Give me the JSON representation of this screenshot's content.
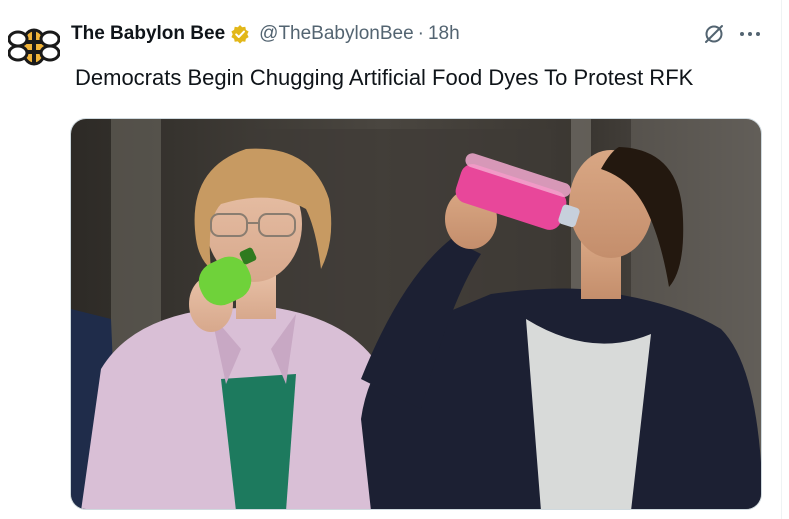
{
  "tweet": {
    "display_name": "The Babylon Bee",
    "handle": "@TheBabylonBee",
    "separator": "·",
    "time": "18h",
    "text": "Democrats Begin Chugging Artificial Food Dyes To Protest RFK",
    "avatar_icon": "bee-logo-icon",
    "verified_icon": "verified-gold-badge-icon",
    "actions": {
      "grok_icon": "grok-icon",
      "more_icon": "more-options-icon"
    },
    "media": {
      "kind": "photo"
    }
  },
  "colors": {
    "text_primary": "#0f1419",
    "text_secondary": "#536471",
    "verified_gold": "#e2b719",
    "bee_yellow": "#f2b53a",
    "bottle_green": "#6fd23a",
    "bottle_pink": "#e8479a"
  }
}
